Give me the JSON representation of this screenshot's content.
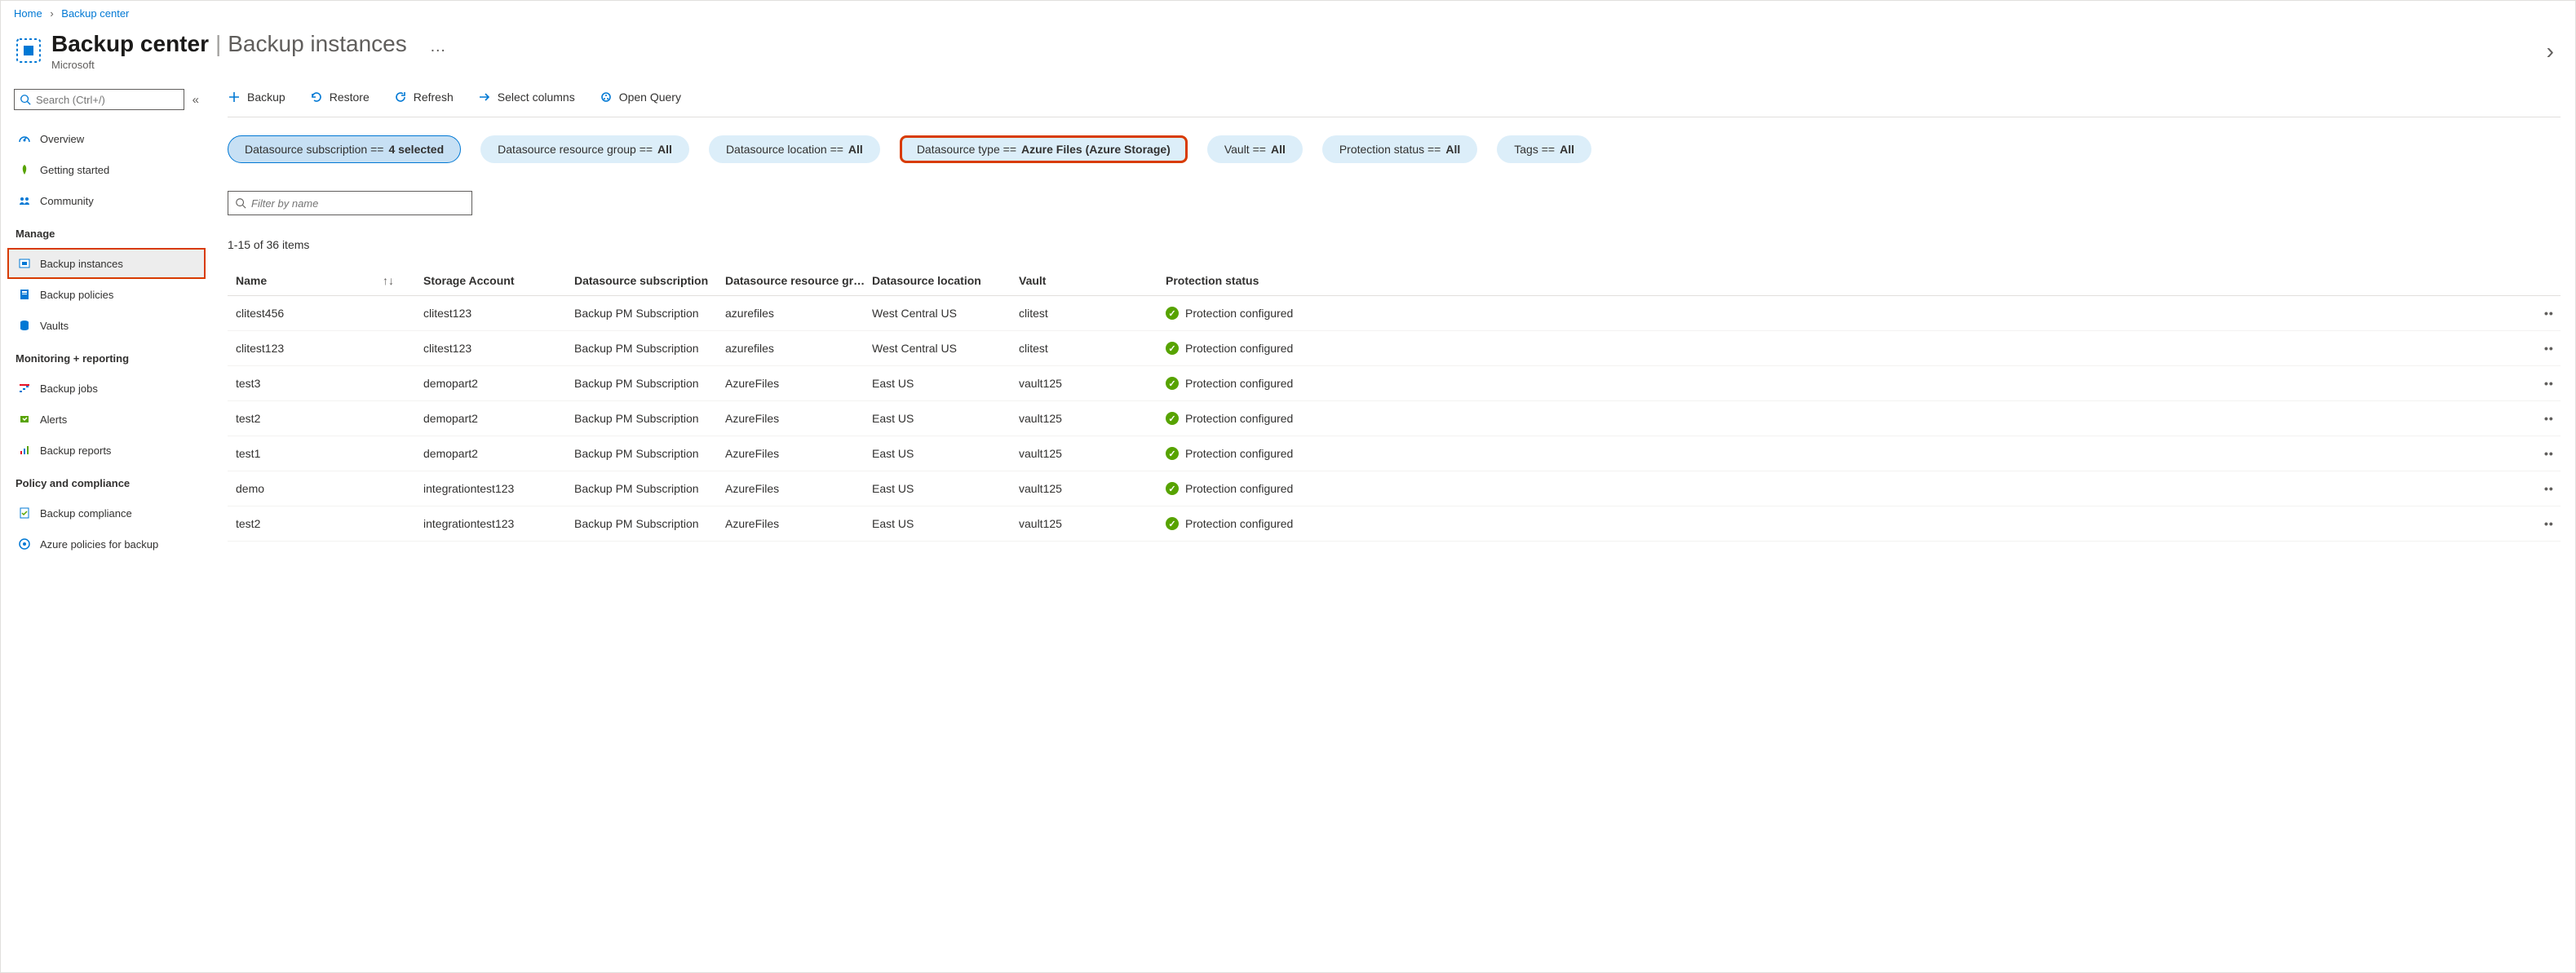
{
  "breadcrumb": {
    "home": "Home",
    "parent": "Backup center"
  },
  "header": {
    "title": "Backup center",
    "sub": "Backup instances",
    "subtitle": "Microsoft",
    "dots": "…"
  },
  "search": {
    "placeholder": "Search (Ctrl+/)"
  },
  "nav": {
    "items": [
      {
        "label": "Overview",
        "icon": "overview-icon"
      },
      {
        "label": "Getting started",
        "icon": "rocket-icon"
      },
      {
        "label": "Community",
        "icon": "people-icon"
      }
    ],
    "manage_label": "Manage",
    "manage_items": [
      {
        "label": "Backup instances",
        "icon": "instances-icon",
        "selected": true
      },
      {
        "label": "Backup policies",
        "icon": "policies-icon"
      },
      {
        "label": "Vaults",
        "icon": "vaults-icon"
      }
    ],
    "monitor_label": "Monitoring + reporting",
    "monitor_items": [
      {
        "label": "Backup jobs",
        "icon": "jobs-icon"
      },
      {
        "label": "Alerts",
        "icon": "alerts-icon"
      },
      {
        "label": "Backup reports",
        "icon": "reports-icon"
      }
    ],
    "policy_label": "Policy and compliance",
    "policy_items": [
      {
        "label": "Backup compliance",
        "icon": "compliance-icon"
      },
      {
        "label": "Azure policies for backup",
        "icon": "azurepol-icon"
      }
    ]
  },
  "toolbar": {
    "backup": "Backup",
    "restore": "Restore",
    "refresh": "Refresh",
    "columns": "Select columns",
    "openquery": "Open Query"
  },
  "filters": {
    "dsub": {
      "label": "Datasource subscription == ",
      "val": "4 selected"
    },
    "drg": {
      "label": "Datasource resource group == ",
      "val": "All"
    },
    "dloc": {
      "label": "Datasource location == ",
      "val": "All"
    },
    "dtype": {
      "label": "Datasource type == ",
      "val": "Azure Files (Azure Storage)"
    },
    "vault": {
      "label": "Vault == ",
      "val": "All"
    },
    "pstatus": {
      "label": "Protection status == ",
      "val": "All"
    },
    "tags": {
      "label": "Tags == ",
      "val": "All"
    }
  },
  "filterbox": {
    "placeholder": "Filter by name"
  },
  "count": "1-15 of 36 items",
  "columns": {
    "name": "Name",
    "storage": "Storage Account",
    "sub": "Datasource subscription",
    "rg": "Datasource resource gr…",
    "loc": "Datasource location",
    "vault": "Vault",
    "status": "Protection status"
  },
  "rows": [
    {
      "name": "clitest456",
      "storage": "clitest123",
      "sub": "Backup PM Subscription",
      "rg": "azurefiles",
      "loc": "West Central US",
      "vault": "clitest",
      "status": "Protection configured"
    },
    {
      "name": "clitest123",
      "storage": "clitest123",
      "sub": "Backup PM Subscription",
      "rg": "azurefiles",
      "loc": "West Central US",
      "vault": "clitest",
      "status": "Protection configured"
    },
    {
      "name": "test3",
      "storage": "demopart2",
      "sub": "Backup PM Subscription",
      "rg": "AzureFiles",
      "loc": "East US",
      "vault": "vault125",
      "status": "Protection configured"
    },
    {
      "name": "test2",
      "storage": "demopart2",
      "sub": "Backup PM Subscription",
      "rg": "AzureFiles",
      "loc": "East US",
      "vault": "vault125",
      "status": "Protection configured"
    },
    {
      "name": "test1",
      "storage": "demopart2",
      "sub": "Backup PM Subscription",
      "rg": "AzureFiles",
      "loc": "East US",
      "vault": "vault125",
      "status": "Protection configured"
    },
    {
      "name": "demo",
      "storage": "integrationtest123",
      "sub": "Backup PM Subscription",
      "rg": "AzureFiles",
      "loc": "East US",
      "vault": "vault125",
      "status": "Protection configured"
    },
    {
      "name": "test2",
      "storage": "integrationtest123",
      "sub": "Backup PM Subscription",
      "rg": "AzureFiles",
      "loc": "East US",
      "vault": "vault125",
      "status": "Protection configured"
    }
  ]
}
